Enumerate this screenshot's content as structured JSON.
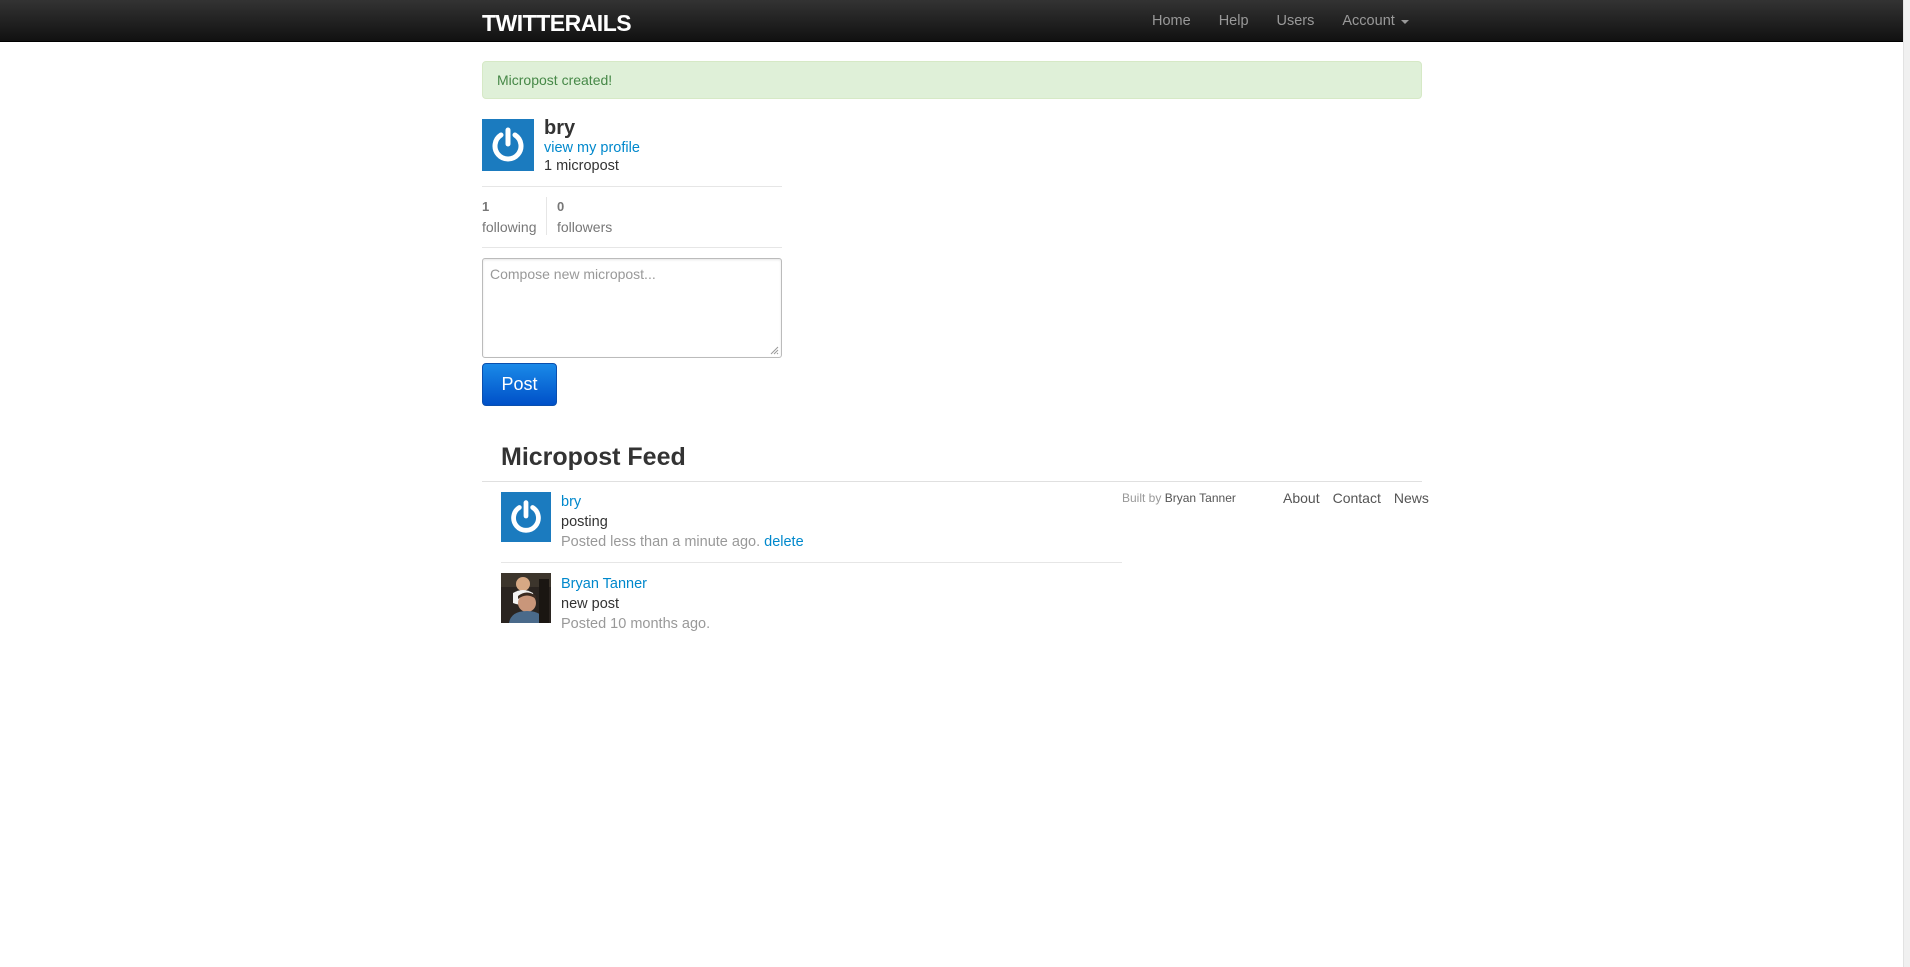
{
  "navbar": {
    "brand": "TWITTERAILS",
    "links": [
      "Home",
      "Help",
      "Users"
    ],
    "account_label": "Account"
  },
  "flash": {
    "message": "Micropost created!"
  },
  "user": {
    "name": "bry",
    "profile_link": "view my profile",
    "micropost_count": "1 micropost"
  },
  "stats": {
    "following_count": "1",
    "following_label": "following",
    "followers_count": "0",
    "followers_label": "followers"
  },
  "compose": {
    "placeholder": "Compose new micropost...",
    "post_button": "Post"
  },
  "feed": {
    "title": "Micropost Feed",
    "items": [
      {
        "user": "bry",
        "content": "posting",
        "timestamp": "Posted less than a minute ago.",
        "delete_label": "delete",
        "avatar": "power-icon-avatar"
      },
      {
        "user": "Bryan Tanner",
        "content": "new post",
        "timestamp": "Posted 10 months ago.",
        "avatar": "photo-avatar"
      }
    ]
  },
  "footer": {
    "built_by_prefix": "Built by",
    "built_by_name": "Bryan Tanner",
    "links": [
      "About",
      "Contact",
      "News"
    ]
  },
  "colors": {
    "navbar": "#1b1b1b",
    "link": "#0088cc",
    "flash_bg": "#dff0d8",
    "flash_text": "#468847",
    "avatar_blue": "#1b7bbf",
    "button_blue": "#0062d9"
  }
}
